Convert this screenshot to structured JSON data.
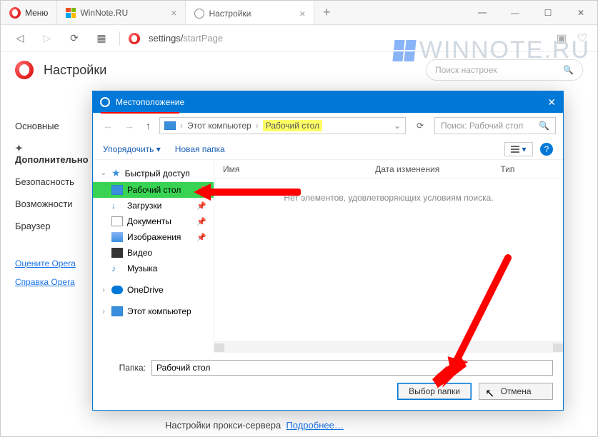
{
  "window": {
    "menu_label": "Меню",
    "tabs": [
      {
        "title": "WinNote.RU",
        "icon": "windows"
      },
      {
        "title": "Настройки",
        "icon": "gear"
      }
    ],
    "active_tab": 1
  },
  "addr": {
    "url_prefix": "settings/",
    "url_page": "startPage"
  },
  "watermark": "WINNOTE.RU",
  "settings": {
    "title": "Настройки",
    "search_placeholder": "Поиск настроек",
    "nav": [
      "Основные",
      "Дополнительно",
      "Безопасность",
      "Возможности",
      "Браузер"
    ],
    "nav_selected": 1,
    "links": [
      "Оцените Opera",
      "Справка Opera"
    ]
  },
  "proxy": {
    "text": "Настройки прокси-сервера",
    "link": "Подробнее…"
  },
  "dialog": {
    "title": "Местоположение",
    "breadcrumbs": {
      "root": "Этот компьютер",
      "leaf": "Рабочий стол"
    },
    "search_placeholder": "Поиск: Рабочий стол",
    "toolbar": {
      "organize": "Упорядочить",
      "new_folder": "Новая папка"
    },
    "tree": {
      "quick_access": "Быстрый доступ",
      "desktop": "Рабочий стол",
      "downloads": "Загрузки",
      "documents": "Документы",
      "pictures": "Изображения",
      "videos": "Видео",
      "music": "Музыка",
      "onedrive": "OneDrive",
      "this_pc": "Этот компьютер"
    },
    "columns": {
      "name": "Имя",
      "date": "Дата изменения",
      "type": "Тип"
    },
    "empty_text": "Нет элементов, удовлетворяющих условиям поиска.",
    "folder_label": "Папка:",
    "folder_value": "Рабочий стол",
    "ok": "Выбор папки",
    "cancel": "Отмена"
  }
}
